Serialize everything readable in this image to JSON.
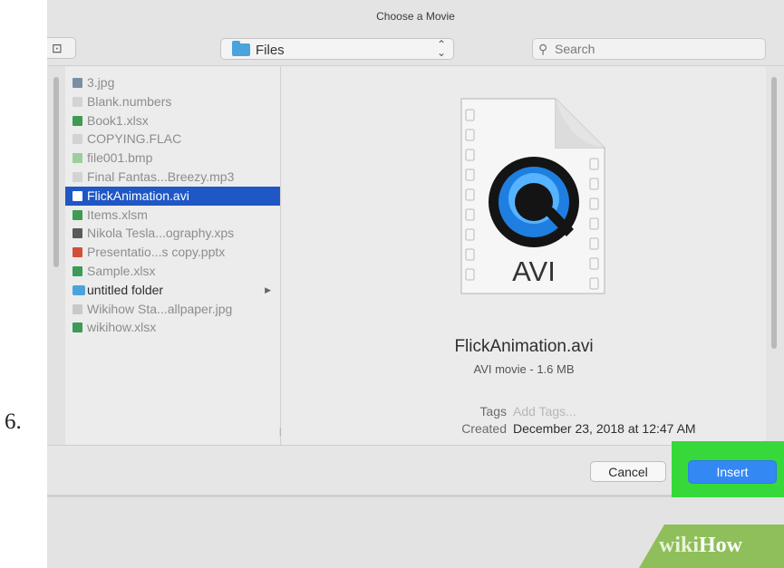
{
  "step_number": "6.",
  "window": {
    "title": "Choose a Movie"
  },
  "toolbar": {
    "location_label": "Files",
    "search_placeholder": "Search"
  },
  "files": [
    {
      "name": "3.jpg",
      "icon": "image-file-icon",
      "icon_color": "#7a8fa3"
    },
    {
      "name": "Blank.numbers",
      "icon": "blank-document-icon",
      "icon_color": "#d3d3d3"
    },
    {
      "name": "Book1.xlsx",
      "icon": "excel-file-icon",
      "icon_color": "#3e9a55"
    },
    {
      "name": "COPYING.FLAC",
      "icon": "blank-document-icon",
      "icon_color": "#d3d3d3"
    },
    {
      "name": "file001.bmp",
      "icon": "image-file-icon",
      "icon_color": "#9ccf9c"
    },
    {
      "name": "Final Fantas...Breezy.mp3",
      "icon": "audio-file-icon",
      "icon_color": "#d3d3d3"
    },
    {
      "name": "FlickAnimation.avi",
      "icon": "movie-file-icon",
      "icon_color": "#ffffff",
      "selected": true
    },
    {
      "name": "Items.xlsm",
      "icon": "excel-macro-file-icon",
      "icon_color": "#3e9a55"
    },
    {
      "name": "Nikola Tesla...ography.xps",
      "icon": "xps-file-icon",
      "icon_color": "#5a5a5a"
    },
    {
      "name": "Presentatio...s copy.pptx",
      "icon": "powerpoint-file-icon",
      "icon_color": "#d2503a"
    },
    {
      "name": "Sample.xlsx",
      "icon": "excel-file-icon",
      "icon_color": "#3e9a55"
    },
    {
      "name": "untitled folder",
      "icon": "folder-icon",
      "icon_color": "#4aa3dc",
      "folder": true
    },
    {
      "name": "Wikihow Sta...allpaper.jpg",
      "icon": "image-file-icon",
      "icon_color": "#c9c9c9"
    },
    {
      "name": "wikihow.xlsx",
      "icon": "excel-file-icon",
      "icon_color": "#3e9a55"
    }
  ],
  "preview": {
    "icon_text": "AVI",
    "filename": "FlickAnimation.avi",
    "kind": "AVI movie - 1.6 MB",
    "tags_label": "Tags",
    "tags_value": "Add Tags...",
    "created_label": "Created",
    "created_value": "December 23, 2018 at 12:47 AM"
  },
  "buttons": {
    "cancel": "Cancel",
    "insert": "Insert"
  },
  "brand": {
    "part1": "wiki",
    "part2": "How"
  },
  "colors": {
    "selection": "#1f57c5",
    "insert_button": "#3488f4",
    "highlight": "#37d93a",
    "brand_tab": "#8fbf5a"
  }
}
